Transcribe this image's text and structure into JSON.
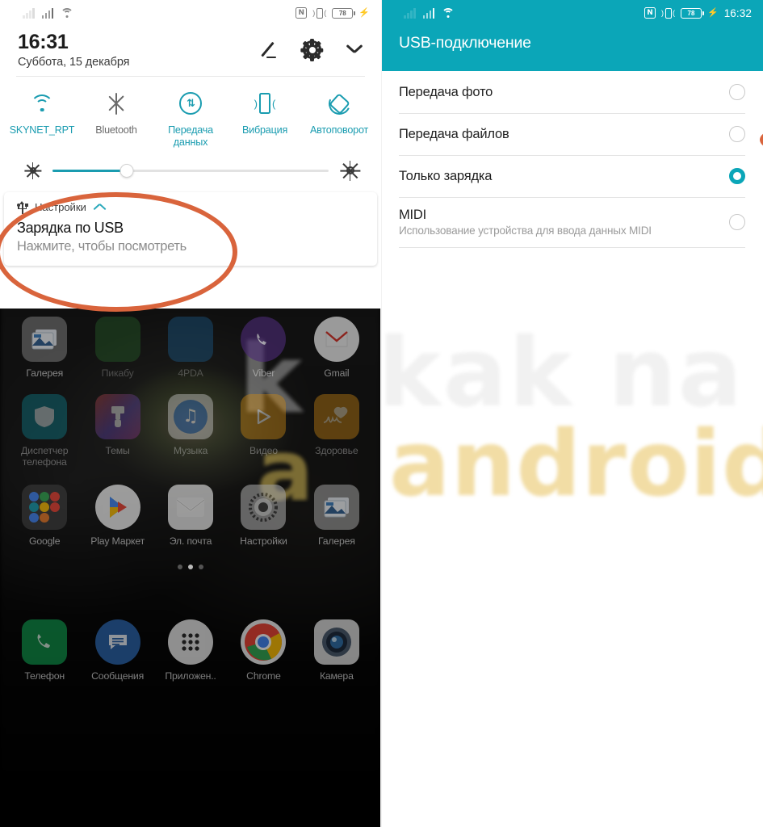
{
  "left_panel": {
    "status_bar": {
      "signal_icons": [
        "signal-bars-sim1",
        "signal-bars-sim2",
        "wifi-icon"
      ],
      "nfc_label": "N",
      "battery_level": "78",
      "charging": true
    },
    "clock": {
      "time": "16:31",
      "date": "Суббота, 15 декабря"
    },
    "actions": [
      {
        "name": "edit-button",
        "icon": "pencil-icon"
      },
      {
        "name": "settings-button",
        "icon": "gear-icon"
      },
      {
        "name": "expand-button",
        "icon": "chevron-down-icon"
      }
    ],
    "toggles": [
      {
        "label": "SKYNET_RPT",
        "icon": "wifi-icon",
        "active": true
      },
      {
        "label": "Bluetooth",
        "icon": "bluetooth-icon",
        "active": false
      },
      {
        "label": "Передача данных",
        "icon": "mobile-data-icon",
        "active": true
      },
      {
        "label": "Вибрация",
        "icon": "vibration-icon",
        "active": true
      },
      {
        "label": "Автоповорот",
        "icon": "auto-rotate-icon",
        "active": true
      }
    ],
    "brightness": {
      "value_percent": 27,
      "low_icon": "sun-small-icon",
      "high_icon": "sun-large-icon"
    },
    "notification": {
      "app_icon": "usb-icon",
      "app_name": "Настройки",
      "collapse_icon": "chevron-up-icon",
      "title": "Зарядка по USB",
      "subtitle": "Нажмите, чтобы посмотреть"
    },
    "home_rows": [
      [
        {
          "label": "Галерея",
          "icon": "gallery-icon"
        },
        {
          "label": "Пикабу",
          "icon": "pikabu-icon"
        },
        {
          "label": "4PDA",
          "icon": "fourpda-icon"
        },
        {
          "label": "Viber",
          "icon": "viber-icon"
        },
        {
          "label": "Gmail",
          "icon": "gmail-icon"
        }
      ],
      [
        {
          "label": "Диспетчер телефона",
          "icon": "phone-manager-icon"
        },
        {
          "label": "Темы",
          "icon": "themes-icon"
        },
        {
          "label": "Музыка",
          "icon": "music-icon"
        },
        {
          "label": "Видео",
          "icon": "video-icon"
        },
        {
          "label": "Здоровье",
          "icon": "health-icon"
        }
      ],
      [
        {
          "label": "Google",
          "icon": "google-folder-icon"
        },
        {
          "label": "Play Маркет",
          "icon": "play-store-icon"
        },
        {
          "label": "Эл. почта",
          "icon": "email-icon"
        },
        {
          "label": "Настройки",
          "icon": "settings-gear-icon"
        },
        {
          "label": "Галерея",
          "icon": "gallery-icon"
        }
      ]
    ],
    "dock": [
      {
        "label": "Телефон",
        "icon": "phone-icon"
      },
      {
        "label": "Сообщения",
        "icon": "messages-icon"
      },
      {
        "label": "Приложен..",
        "icon": "app-drawer-icon"
      },
      {
        "label": "Chrome",
        "icon": "chrome-icon"
      },
      {
        "label": "Камера",
        "icon": "camera-icon"
      }
    ]
  },
  "right_panel": {
    "status_bar": {
      "nfc_label": "N",
      "battery_level": "78",
      "charging": true,
      "clock": "16:32"
    },
    "title": "USB-подключение",
    "options": [
      {
        "label": "Передача фото",
        "description": "",
        "selected": false
      },
      {
        "label": "Передача файлов",
        "description": "",
        "selected": false
      },
      {
        "label": "Только зарядка",
        "description": "",
        "selected": true
      },
      {
        "label": "MIDI",
        "description": "Использование устройства для ввода данных MIDI",
        "selected": false
      }
    ]
  },
  "watermark": {
    "line1": "kak na",
    "line2": "android",
    "left_fragment_top": "k",
    "left_fragment_bottom": "a"
  },
  "annotations": {
    "highlight_color": "#d9643c",
    "left_target": "Зарядка по USB",
    "right_target": "Передача файлов"
  },
  "colors": {
    "accent_teal": "#0ba6b8",
    "toggle_on": "#1a9cb0",
    "annotation_orange": "#d9643c"
  }
}
